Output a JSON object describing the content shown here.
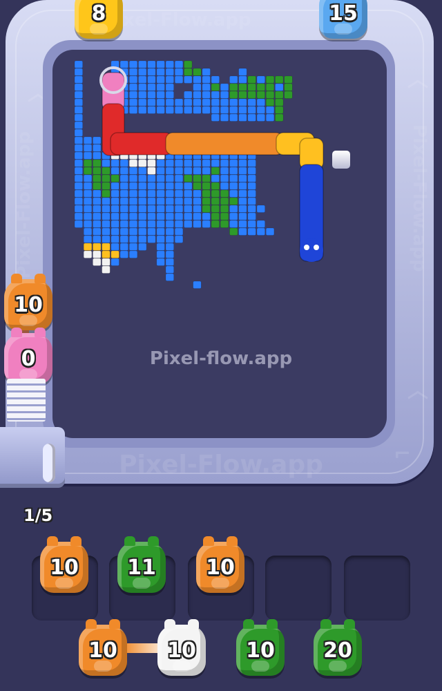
{
  "watermark_text": "Pixel-flow.app",
  "track_watermark_text": "Pixel-Flow.app",
  "queue_progress": "1/5",
  "colors": {
    "blue": "#2b7fff",
    "green": "#2e9a2a",
    "white": "#f2f2f2",
    "yellow": "#ffc020",
    "orange": "#f08a2a",
    "red": "#e02a2a",
    "pink": "#f080c0",
    "navy": "#1f45d8"
  },
  "board": {
    "rows": [
      "B...BBBBBBBBG...........",
      "B...BBBBBBBBGGB...B.....",
      "B...BBBBBBBBBBBB.BBGBGGG",
      "B...BBBBBBB..BBGBGGGGGBG",
      "B...BBBBBBB.BBBBBGGGGGGG",
      "B...BBBBBBBBBBBBBBBBBGG.",
      "B...BBBBBBBBBBBBBBBBBBG.",
      "B..............BBBBBBBG.",
      "B.......................",
      "B.......................",
      "BBBBBBBBBBBBBBBBBBBB....",
      "BBBBBBBYBBBBBBBBBBBB....",
      "BBBBWWWWWWBBBBBBBBBB....",
      "BGGBBBWWWBBBBBBBBBBB....",
      "BGGGBBBBWBBBBBBGBBBB....",
      "BBGGGBBBBBBBGGGBBBBB....",
      "BBGGBBBBBBBBBGGGBBBB....",
      "BBBGBBBBBBBBBBGGGBBB....",
      "BBBBBBBBBBBBBBGGGGBB....",
      "BBBBBBBBBBBBBBGGGBBBB...",
      "BBBBBBBBBBBBBBBGGBBB....",
      "BBBBBBBBBBBBBBBGGBBBB...",
      ".BBBBBBBBBBB.....GBBBB..",
      ".BBBBBBBBBBB............",
      ".YYYBBBB.BB.............",
      ".WWYYBB..BB.............",
      "..WWB....BB.............",
      "...W......B.............",
      "..........B.............",
      ".............B.........."
    ]
  },
  "snake": {
    "segments": [
      "pink",
      "red",
      "orange",
      "yellow",
      "navy"
    ]
  },
  "top_pigs": [
    {
      "color": "#ffc61a",
      "count": "8"
    },
    {
      "color": "#5aa8f0",
      "count": "15"
    }
  ],
  "side_pigs": [
    {
      "color": "#f08a2a",
      "count": "10"
    },
    {
      "color": "#f080c0",
      "count": "0"
    }
  ],
  "holding_slots": [
    {
      "filled": true,
      "color": "#f08a2a",
      "count": "10"
    },
    {
      "filled": true,
      "color": "#2e9a2a",
      "count": "11"
    },
    {
      "filled": true,
      "color": "#f08a2a",
      "count": "10"
    },
    {
      "filled": false
    },
    {
      "filled": false
    }
  ],
  "queue_pigs": [
    {
      "color": "#f08a2a",
      "count": "10"
    },
    {
      "color": "#f4f4f4",
      "count": "10"
    },
    {
      "color": "#2e9a2a",
      "count": "10"
    },
    {
      "color": "#2e9a2a",
      "count": "20"
    }
  ]
}
